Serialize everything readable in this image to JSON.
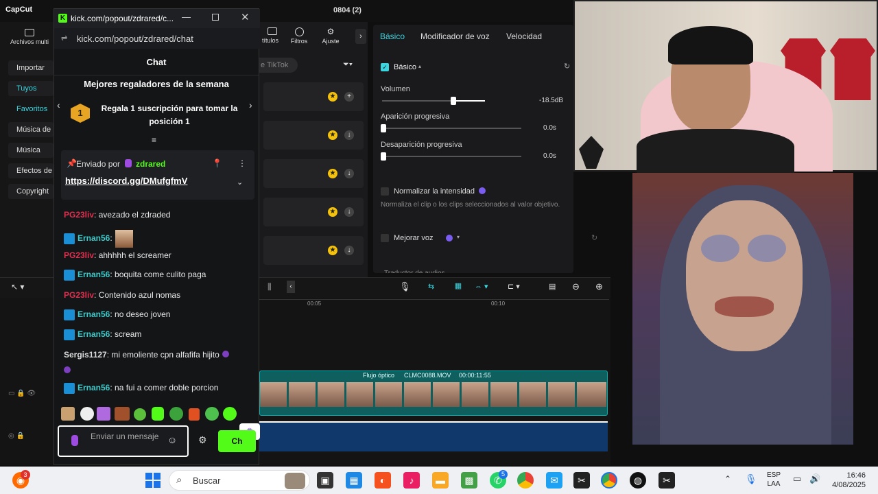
{
  "capcut": {
    "app_title": "CapCut",
    "project_name": "0804 (2)",
    "toolbar": {
      "media_label": "Archivos multi",
      "captions_label": "títulos",
      "filters_label": "Filtros",
      "adjust_label": "Ajuste"
    },
    "sidebar": {
      "items": [
        {
          "label": "Importar"
        },
        {
          "label": "Tuyos"
        },
        {
          "label": "Favoritos"
        },
        {
          "label": "Música de"
        },
        {
          "label": "Música"
        },
        {
          "label": "Efectos de"
        },
        {
          "label": "Copyright"
        }
      ]
    },
    "media_panel": {
      "search_hint": "e TikTok"
    },
    "properties": {
      "tabs": [
        "Básico",
        "Modificador de voz",
        "Velocidad"
      ],
      "section_title": "Básico",
      "volume_label": "Volumen",
      "volume_value": "-18.5dB",
      "fade_in_label": "Aparición progresiva",
      "fade_in_value": "0.0s",
      "fade_out_label": "Desaparición progresiva",
      "fade_out_value": "0.0s",
      "normalize_label": "Normalizar la intensidad",
      "normalize_desc": "Normaliza el clip o los clips seleccionados al valor objetivo.",
      "enhance_label": "Mejorar voz",
      "translator_label": "Traductor de audios"
    },
    "timeline": {
      "ruler_marks": [
        "00:05",
        "00:10"
      ],
      "clip_label": "Flujo óptico",
      "clip_name": "CLMC0088.MOV",
      "clip_duration": "00:00:11:55"
    }
  },
  "kick": {
    "window_title": "kick.com/popout/zdrared/c...",
    "url": "kick.com/popout/zdrared/chat",
    "chat_title": "Chat",
    "leaderboard_title": "Mejores regaladores de la semana",
    "leaderboard_rank": "1",
    "leaderboard_text": "Regala 1 suscripción para tomar la posición 1",
    "pinned": {
      "sent_by": "Enviado por",
      "user": "zdrared",
      "link": "https://discord.gg/DMufgfmV"
    },
    "messages": [
      {
        "user": "PG23liv",
        "text": ": avezado el zdraded",
        "style": "red"
      },
      {
        "user": "Ernan56",
        "text": ":",
        "style": "teal"
      },
      {
        "user": "PG23liv",
        "text": ": ahhhhh el screamer",
        "style": "red"
      },
      {
        "user": "Ernan56",
        "text": ": boquita come culito paga",
        "style": "teal"
      },
      {
        "user": "PG23liv",
        "text": ": Contenido azul nomas",
        "style": "red"
      },
      {
        "user": "Ernan56",
        "text": ": no deseo joven",
        "style": "teal"
      },
      {
        "user": "Ernan56",
        "text": ": scream",
        "style": "teal"
      },
      {
        "user": "Sergis1127",
        "text": ": mi emoliente cpn alfafifa hijito",
        "style": "white"
      },
      {
        "user": "Ernan56",
        "text": ": na fui a comer doble porcion",
        "style": "teal"
      }
    ],
    "input_placeholder": "Enviar un mensaje",
    "send_label": "Ch"
  },
  "taskbar": {
    "search_placeholder": "Buscar",
    "notification_count": "3",
    "whatsapp_badge": "5",
    "lang_top": "ESP",
    "lang_bottom": "LAA",
    "time": "16:46",
    "date": "4/08/2025"
  },
  "colors": {
    "kick_green": "#53fc18",
    "capcut_accent": "#3cd6e0",
    "taskbar_bg": "#eef0f4"
  }
}
